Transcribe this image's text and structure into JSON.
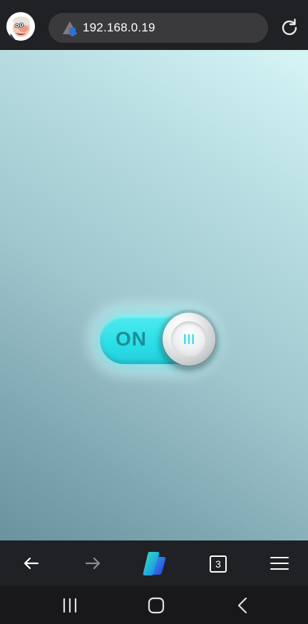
{
  "browser": {
    "url": "192.168.0.19",
    "tab_count": "3"
  },
  "page": {
    "toggle": {
      "label": "ON",
      "state": "on",
      "accent_color": "#2ee3ec"
    }
  },
  "icons": {
    "avatar": "profile-avatar",
    "site": "site-info-icon",
    "reload": "reload-icon",
    "back": "back-arrow-icon",
    "forward": "forward-arrow-icon",
    "copilot": "copilot-icon",
    "menu": "hamburger-menu-icon",
    "recents": "recents-icon",
    "home": "home-icon",
    "system_back": "chevron-left-icon"
  }
}
